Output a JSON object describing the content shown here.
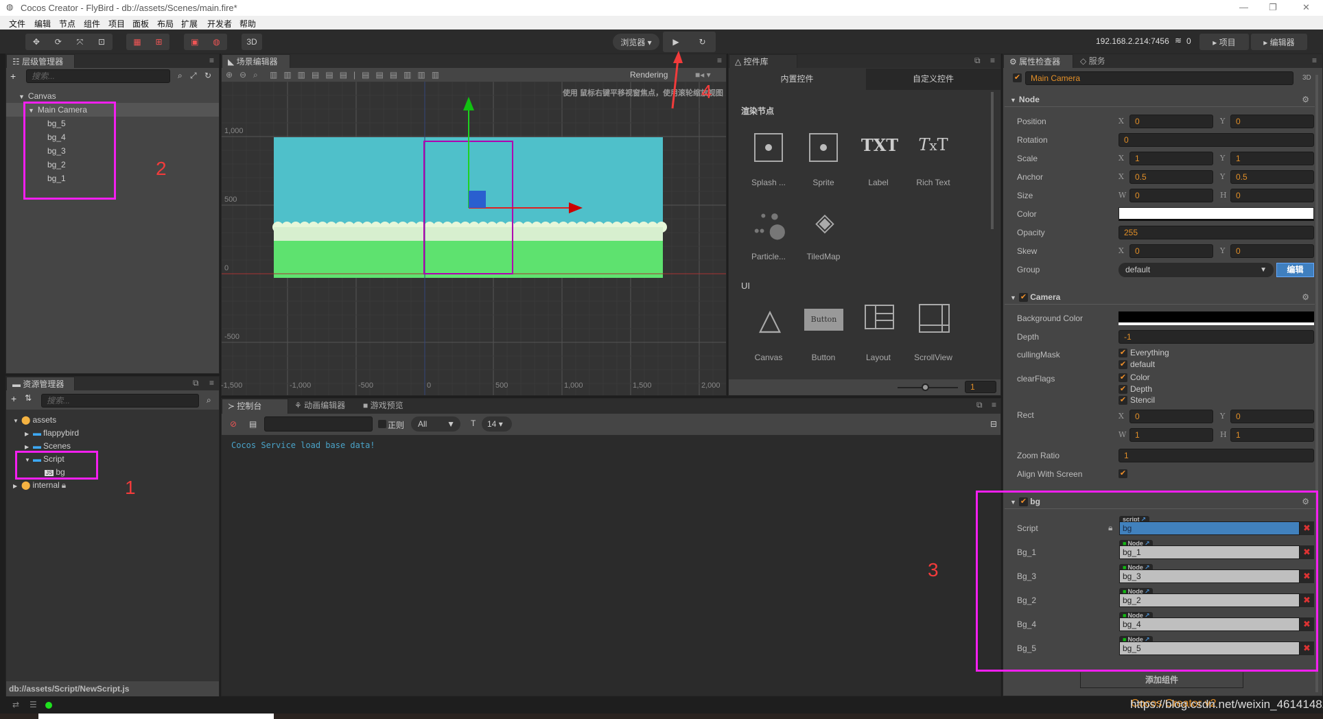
{
  "window": {
    "title": "Cocos Creator - FlyBird - db://assets/Scenes/main.fire*",
    "minimize": "—",
    "restore": "❐",
    "close": "✕"
  },
  "menu": [
    "文件",
    "编辑",
    "节点",
    "组件",
    "项目",
    "面板",
    "布局",
    "扩展",
    "开发者",
    "帮助"
  ],
  "toolbar": {
    "mode_3d": "3D",
    "browser": "浏览器 ▾",
    "ip": "192.168.2.214:7456",
    "connections": "0",
    "project_btn": "项目",
    "editor_btn": "编辑器"
  },
  "hierarchy": {
    "tab": "层级管理器",
    "search_placeholder": "搜索...",
    "items": [
      {
        "label": "Canvas",
        "depth": 0,
        "expanded": true
      },
      {
        "label": "Main Camera",
        "depth": 1,
        "expanded": true,
        "selected": true
      },
      {
        "label": "bg_5",
        "depth": 2
      },
      {
        "label": "bg_4",
        "depth": 2
      },
      {
        "label": "bg_3",
        "depth": 2
      },
      {
        "label": "bg_2",
        "depth": 2
      },
      {
        "label": "bg_1",
        "depth": 2
      }
    ]
  },
  "assets": {
    "tab": "资源管理器",
    "search_placeholder": "搜索...",
    "items": [
      {
        "label": "assets",
        "depth": 0,
        "type": "db",
        "arrow": "down"
      },
      {
        "label": "flappybird",
        "depth": 1,
        "type": "folder",
        "arrow": "right"
      },
      {
        "label": "Scenes",
        "depth": 1,
        "type": "folder",
        "arrow": "right"
      },
      {
        "label": "Script",
        "depth": 1,
        "type": "folder",
        "arrow": "down"
      },
      {
        "label": "bg",
        "depth": 2,
        "type": "js"
      },
      {
        "label": "internal",
        "depth": 0,
        "type": "db",
        "arrow": "right",
        "locked": true
      }
    ],
    "path": "db://assets/Script/NewScript.js"
  },
  "scene": {
    "tab": "场景编辑器",
    "rendering": "Rendering",
    "hint": "使用 鼠标右键平移视窗焦点，使用滚轮缩放视图",
    "x_ticks": [
      "-1,500",
      "-1,000",
      "-500",
      "0",
      "500",
      "1,000",
      "1,500",
      "2,000"
    ],
    "y_ticks": [
      "1,000",
      "500",
      "0",
      "-500"
    ],
    "colors": {
      "sky": "#4fc0ca",
      "grass": "#5ee26f",
      "selection": "#b000b0"
    }
  },
  "library": {
    "tab": "控件库",
    "tabs": [
      "内置控件",
      "自定义控件"
    ],
    "sections": [
      {
        "title": "渲染节点",
        "items": [
          "Splash ...",
          "Sprite",
          "Label",
          "Rich Text",
          "Particle...",
          "TiledMap"
        ]
      },
      {
        "title": "UI",
        "items": [
          "Canvas",
          "Button",
          "Layout",
          "ScrollView"
        ]
      }
    ],
    "button_icon_text": "Button",
    "label_icon_text": "TXT",
    "zoom": "1"
  },
  "console": {
    "tabs": [
      "控制台",
      "动画编辑器",
      "游戏预览"
    ],
    "regex_label": "正则",
    "level": "All",
    "font_size": "14",
    "messages": [
      "Cocos Service load base data!"
    ]
  },
  "inspector": {
    "tabs": [
      "属性检查器",
      "服务"
    ],
    "node_name": "Main Camera",
    "badge_3d": "3D",
    "node": {
      "title": "Node",
      "position": {
        "label": "Position",
        "x": "0",
        "y": "0"
      },
      "rotation": {
        "label": "Rotation",
        "value": "0"
      },
      "scale": {
        "label": "Scale",
        "x": "1",
        "y": "1"
      },
      "anchor": {
        "label": "Anchor",
        "x": "0.5",
        "y": "0.5"
      },
      "size": {
        "label": "Size",
        "w": "0",
        "h": "0"
      },
      "color": {
        "label": "Color",
        "value": "#ffffff"
      },
      "opacity": {
        "label": "Opacity",
        "value": "255"
      },
      "skew": {
        "label": "Skew",
        "x": "0",
        "y": "0"
      },
      "group": {
        "label": "Group",
        "value": "default",
        "edit": "编辑"
      }
    },
    "camera": {
      "title": "Camera",
      "background_color": {
        "label": "Background Color",
        "value": "#000000"
      },
      "depth": {
        "label": "Depth",
        "value": "-1"
      },
      "culling_mask": {
        "label": "cullingMask",
        "options": [
          "Everything",
          "default"
        ]
      },
      "clear_flags": {
        "label": "clearFlags",
        "options": [
          "Color",
          "Depth",
          "Stencil"
        ]
      },
      "rect": {
        "label": "Rect",
        "x": "0",
        "y": "0",
        "w": "1",
        "h": "1"
      },
      "zoom_ratio": {
        "label": "Zoom Ratio",
        "value": "1"
      },
      "align_with_screen": {
        "label": "Align With Screen",
        "checked": true
      }
    },
    "bg": {
      "title": "bg",
      "script": {
        "label": "Script",
        "tag": "script",
        "value": "bg"
      },
      "props": [
        {
          "label": "Bg_1",
          "tag": "Node",
          "value": "bg_1"
        },
        {
          "label": "Bg_3",
          "tag": "Node",
          "value": "bg_3"
        },
        {
          "label": "Bg_2",
          "tag": "Node",
          "value": "bg_2"
        },
        {
          "label": "Bg_4",
          "tag": "Node",
          "value": "bg_4"
        },
        {
          "label": "Bg_5",
          "tag": "Node",
          "value": "bg_5"
        }
      ]
    },
    "add_component": "添加组件",
    "axis_labels": {
      "x": "X",
      "y": "Y",
      "w": "W",
      "h": "H"
    }
  },
  "annotations": [
    "1",
    "2",
    "3",
    "4"
  ],
  "watermark": {
    "url": "https://blog.csdn.net/weixin_46141482",
    "overlay": "Cocos Creator v2"
  },
  "accent": "#e38f27"
}
